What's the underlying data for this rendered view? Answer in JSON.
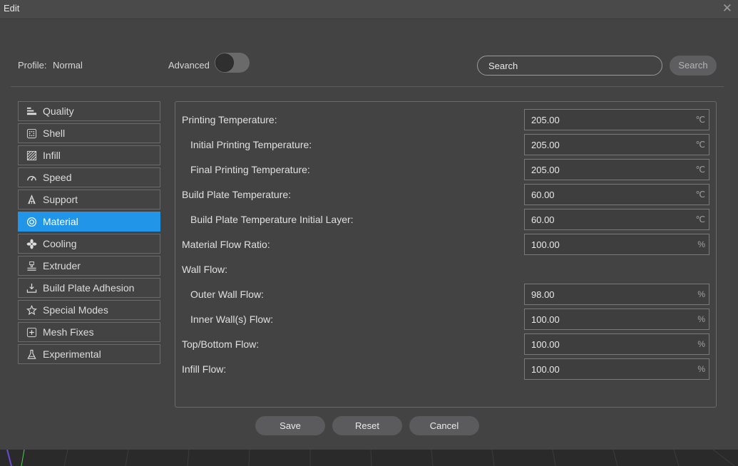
{
  "window": {
    "title": "Edit",
    "close_icon": "close-icon"
  },
  "profile": {
    "label": "Profile:",
    "value": "Normal"
  },
  "advanced": {
    "label": "Advanced",
    "enabled": false
  },
  "search": {
    "placeholder": "Search",
    "button_label": "Search"
  },
  "sidebar": {
    "items": [
      {
        "label": "Quality",
        "icon": "quality-icon",
        "active": false
      },
      {
        "label": "Shell",
        "icon": "shell-icon",
        "active": false
      },
      {
        "label": "Infill",
        "icon": "infill-icon",
        "active": false
      },
      {
        "label": "Speed",
        "icon": "speed-icon",
        "active": false
      },
      {
        "label": "Support",
        "icon": "support-icon",
        "active": false
      },
      {
        "label": "Material",
        "icon": "material-icon",
        "active": true
      },
      {
        "label": "Cooling",
        "icon": "fan-icon",
        "active": false
      },
      {
        "label": "Extruder",
        "icon": "extruder-icon",
        "active": false
      },
      {
        "label": "Build Plate Adhesion",
        "icon": "adhesion-icon",
        "active": false
      },
      {
        "label": "Special Modes",
        "icon": "star-icon",
        "active": false
      },
      {
        "label": "Mesh Fixes",
        "icon": "plus-box-icon",
        "active": false
      },
      {
        "label": "Experimental",
        "icon": "flask-icon",
        "active": false
      }
    ]
  },
  "settings": {
    "rows": [
      {
        "label": "Printing Temperature:",
        "value": "205.00",
        "unit": "℃",
        "indent": false
      },
      {
        "label": "Initial Printing Temperature:",
        "value": "205.00",
        "unit": "℃",
        "indent": true
      },
      {
        "label": "Final Printing Temperature:",
        "value": "205.00",
        "unit": "℃",
        "indent": true
      },
      {
        "label": "Build Plate Temperature:",
        "value": "60.00",
        "unit": "℃",
        "indent": false
      },
      {
        "label": "Build Plate Temperature Initial Layer:",
        "value": "60.00",
        "unit": "℃",
        "indent": true
      },
      {
        "label": "Material Flow Ratio:",
        "value": "100.00",
        "unit": "%",
        "indent": false
      },
      {
        "label": "Wall Flow:",
        "value": null,
        "unit": null,
        "indent": false
      },
      {
        "label": "Outer Wall Flow:",
        "value": "98.00",
        "unit": "%",
        "indent": true
      },
      {
        "label": "Inner Wall(s) Flow:",
        "value": "100.00",
        "unit": "%",
        "indent": true
      },
      {
        "label": "Top/Bottom Flow:",
        "value": "100.00",
        "unit": "%",
        "indent": false
      },
      {
        "label": "Infill Flow:",
        "value": "100.00",
        "unit": "%",
        "indent": false
      }
    ]
  },
  "actions": {
    "save_label": "Save",
    "reset_label": "Reset",
    "cancel_label": "Cancel"
  },
  "colors": {
    "accent": "#2196e8",
    "background": "#434344",
    "titlebar": "#4a4a4b"
  }
}
